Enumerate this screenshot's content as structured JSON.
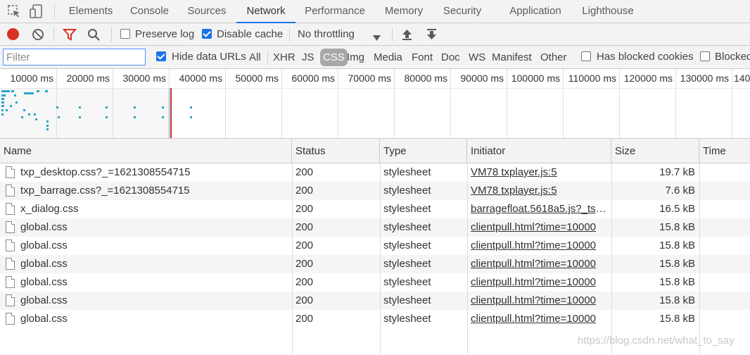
{
  "tabs": [
    {
      "label": "Elements",
      "active": false
    },
    {
      "label": "Console",
      "active": false
    },
    {
      "label": "Sources",
      "active": false
    },
    {
      "label": "Network",
      "active": true
    },
    {
      "label": "Performance",
      "active": false
    },
    {
      "label": "Memory",
      "active": false
    },
    {
      "label": "Security",
      "active": false
    },
    {
      "label": "Application",
      "active": false
    },
    {
      "label": "Lighthouse",
      "active": false
    }
  ],
  "toolbar": {
    "preserve_log_label": "Preserve log",
    "preserve_log_checked": false,
    "disable_cache_label": "Disable cache",
    "disable_cache_checked": true,
    "throttling_value": "No throttling",
    "record_color": "#d93025",
    "filter_icon_color": "#d93025"
  },
  "filter": {
    "placeholder": "Filter",
    "value": "",
    "hide_data_urls_label": "Hide data URLs",
    "hide_data_urls_checked": true,
    "types": [
      {
        "label": "All",
        "active": false
      },
      {
        "label": "XHR",
        "active": false
      },
      {
        "label": "JS",
        "active": false
      },
      {
        "label": "CSS",
        "active": true
      },
      {
        "label": "Img",
        "active": false
      },
      {
        "label": "Media",
        "active": false
      },
      {
        "label": "Font",
        "active": false
      },
      {
        "label": "Doc",
        "active": false
      },
      {
        "label": "WS",
        "active": false
      },
      {
        "label": "Manifest",
        "active": false
      },
      {
        "label": "Other",
        "active": false
      }
    ],
    "has_blocked_cookies_label": "Has blocked cookies",
    "has_blocked_cookies_checked": false,
    "blocked_requests_label": "Blocked",
    "blocked_requests_checked": false
  },
  "overview": {
    "ticks": [
      "10000 ms",
      "20000 ms",
      "30000 ms",
      "40000 ms",
      "50000 ms",
      "60000 ms",
      "70000 ms",
      "80000 ms",
      "90000 ms",
      "100000 ms",
      "110000 ms",
      "120000 ms",
      "130000 ms",
      "140"
    ],
    "bar_color": "#2aa6c8",
    "load_line_color": "#c0392b"
  },
  "table": {
    "columns": [
      "Name",
      "Status",
      "Type",
      "Initiator",
      "Size",
      "Time"
    ],
    "rows": [
      {
        "name": "txp_desktop.css?_=1621308554715",
        "status": "200",
        "type": "stylesheet",
        "initiator": "VM78 txplayer.js:5",
        "size": "19.7 kB",
        "time": ""
      },
      {
        "name": "txp_barrage.css?_=1621308554715",
        "status": "200",
        "type": "stylesheet",
        "initiator": "VM78 txplayer.js:5",
        "size": "7.6 kB",
        "time": ""
      },
      {
        "name": "x_dialog.css",
        "status": "200",
        "type": "stylesheet",
        "initiator": "barragefloat.5618a5.js?_ts=…",
        "size": "16.5 kB",
        "time": ""
      },
      {
        "name": "global.css",
        "status": "200",
        "type": "stylesheet",
        "initiator": "clientpull.html?time=10000",
        "size": "15.8 kB",
        "time": ""
      },
      {
        "name": "global.css",
        "status": "200",
        "type": "stylesheet",
        "initiator": "clientpull.html?time=10000",
        "size": "15.8 kB",
        "time": ""
      },
      {
        "name": "global.css",
        "status": "200",
        "type": "stylesheet",
        "initiator": "clientpull.html?time=10000",
        "size": "15.8 kB",
        "time": ""
      },
      {
        "name": "global.css",
        "status": "200",
        "type": "stylesheet",
        "initiator": "clientpull.html?time=10000",
        "size": "15.8 kB",
        "time": ""
      },
      {
        "name": "global.css",
        "status": "200",
        "type": "stylesheet",
        "initiator": "clientpull.html?time=10000",
        "size": "15.8 kB",
        "time": ""
      },
      {
        "name": "global.css",
        "status": "200",
        "type": "stylesheet",
        "initiator": "clientpull.html?time=10000",
        "size": "15.8 kB",
        "time": ""
      }
    ]
  },
  "watermark": "https://blog.csdn.net/what_to_say"
}
